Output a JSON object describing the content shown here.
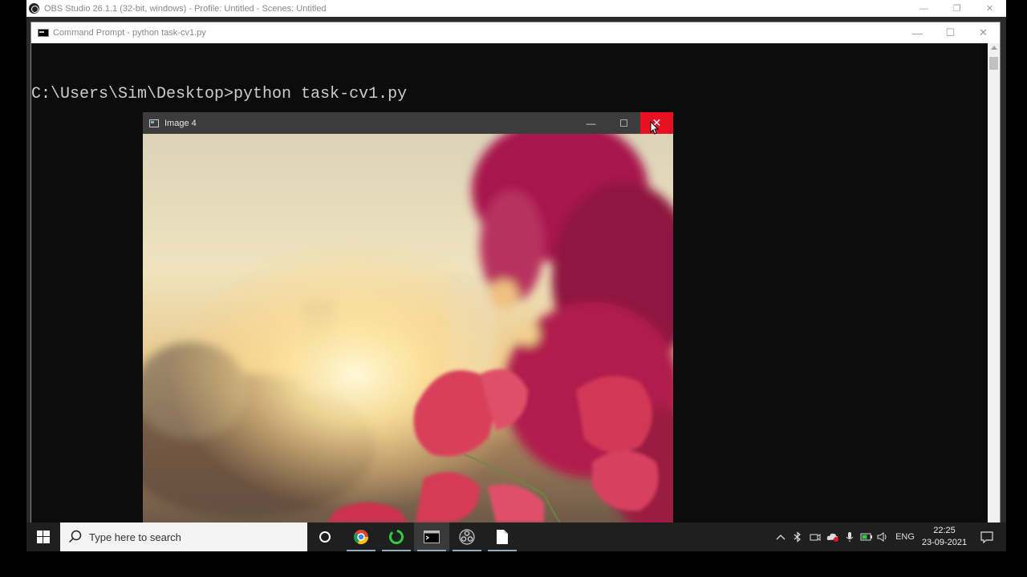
{
  "obs": {
    "title": "OBS Studio 26.1.1 (32-bit, windows) - Profile: Untitled - Scenes: Untitled",
    "controls": {
      "minimize": "—",
      "restore": "❐",
      "close": "✕"
    }
  },
  "cmd": {
    "title": "Command Prompt - python  task-cv1.py",
    "prompt_line": "C:\\Users\\Sim\\Desktop>python task-cv1.py",
    "controls": {
      "minimize": "—",
      "maximize": "☐",
      "close": "✕"
    }
  },
  "image_window": {
    "title": "Image 4",
    "controls": {
      "minimize": "—",
      "maximize": "☐",
      "close": "✕"
    }
  },
  "taskbar": {
    "search_placeholder": "Type here to search",
    "apps": [
      {
        "name": "cortana-icon"
      },
      {
        "name": "chrome-icon"
      },
      {
        "name": "loading-app-icon"
      },
      {
        "name": "command-prompt-icon"
      },
      {
        "name": "obs-icon"
      },
      {
        "name": "file-icon"
      }
    ],
    "tray": {
      "language": "ENG",
      "time": "22:25",
      "date": "23-09-2021"
    }
  },
  "colors": {
    "close_active": "#e81123",
    "cmd_text": "#cccccc",
    "taskbar_bg": "#1f1f1f"
  }
}
